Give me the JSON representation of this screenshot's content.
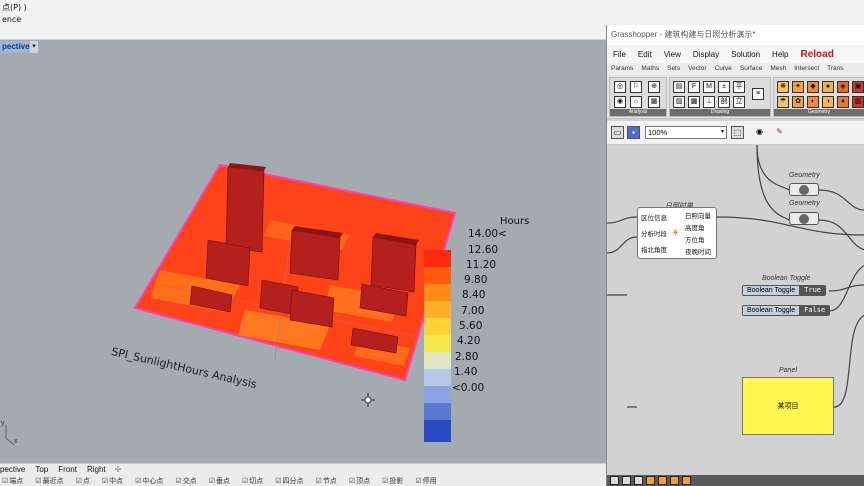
{
  "rhino": {
    "menu_line1": "点(P) )",
    "menu_line2": "ence",
    "viewport_tab": "pective",
    "view_tabs": [
      "pective",
      "Top",
      "Front",
      "Right"
    ],
    "add_view_symbol": "✢",
    "osnaps": [
      "端点",
      "最近点",
      "点",
      "中点",
      "中心点",
      "交点",
      "垂点",
      "切点",
      "四分点",
      "节点",
      "顶点",
      "投影",
      "停用"
    ],
    "axis_y": "y",
    "axis_x": "x",
    "analysis_caption": "SPI_SunlightHours Analysis",
    "legend": {
      "title": "Hours",
      "labels": [
        "14.00<",
        "12.60",
        "11.20",
        "9.80",
        "8.40",
        "7.00",
        "5.60",
        "4.20",
        "2.80",
        "1.40",
        "<0.00"
      ],
      "colors": [
        "#ff2a0d",
        "#ff5a10",
        "#ff8a1a",
        "#ffb02a",
        "#ffd23a",
        "#f5e84c",
        "#e0e6c0",
        "#b9c7e6",
        "#8ea4e2",
        "#5b79d2",
        "#2a4bc2"
      ]
    }
  },
  "grasshopper": {
    "title": "Grasshopper - 建筑构建与日照分析演示*",
    "menu": [
      "File",
      "Edit",
      "View",
      "Display",
      "Solution",
      "Help"
    ],
    "reload": "Reload",
    "tabs": [
      "Params",
      "Maths",
      "Sets",
      "Vector",
      "Curve",
      "Surface",
      "Mesh",
      "Intersect",
      "Trans"
    ],
    "ribbon_groups": [
      "Analysis",
      "Drawing",
      "Geometry"
    ],
    "zoom": "100%",
    "components": {
      "geometry_label": "Geometry",
      "sunlight_label": "日照时量",
      "sunlight_inputs": [
        "区位信息",
        "分析时段",
        "指北角度"
      ],
      "sunlight_outputs": [
        "日照向量",
        "高度角",
        "方位角",
        "夜晚时间"
      ],
      "toggle_label": "Boolean Toggle",
      "toggle1_name": "Boolean Toggle",
      "toggle1_value": "True",
      "toggle2_name": "Boolean Toggle",
      "toggle2_value": "False",
      "panel_label": "Panel",
      "panel_text": "某项目"
    }
  }
}
